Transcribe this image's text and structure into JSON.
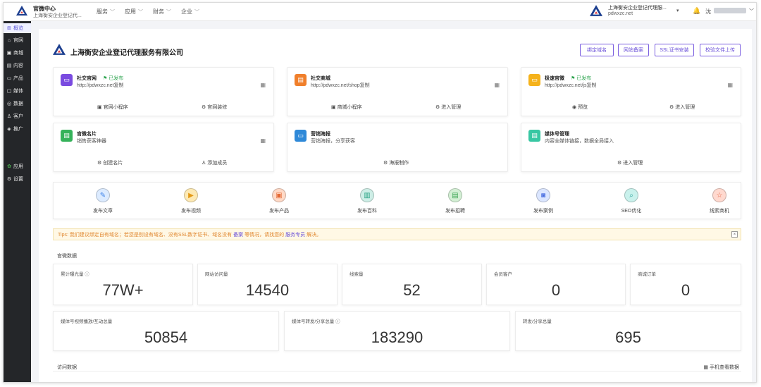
{
  "topbar": {
    "app_title": "官微中心",
    "app_subtitle": "上海衡安企业登记代...",
    "nav": [
      "服务",
      "应用",
      "财务",
      "企业"
    ],
    "account_name": "上海衡安企业登记代理服...",
    "account_domain": "pdwxzc.net",
    "user_name": "沈"
  },
  "sidebar": {
    "items": [
      {
        "label": "概览",
        "icon": "grid-icon"
      },
      {
        "label": "官网",
        "icon": "home-icon"
      },
      {
        "label": "商城",
        "icon": "shop-icon"
      },
      {
        "label": "内容",
        "icon": "file-icon"
      },
      {
        "label": "产品",
        "icon": "box-icon"
      },
      {
        "label": "媒体",
        "icon": "media-icon"
      },
      {
        "label": "数据",
        "icon": "data-icon"
      },
      {
        "label": "客户",
        "icon": "user-icon"
      },
      {
        "label": "推广",
        "icon": "megaphone-icon"
      }
    ],
    "bottom": [
      {
        "label": "应用",
        "icon": "apps-icon"
      },
      {
        "label": "设置",
        "icon": "gear-icon"
      }
    ]
  },
  "main": {
    "company": "上海衡安企业登记代理服务有限公司",
    "buttons": [
      "绑定域名",
      "网站备案",
      "SSL证书安装",
      "校验文件上传"
    ],
    "cards": [
      {
        "title": "社交官网",
        "badge": "已发布",
        "sub": "http://pdwxzc.net复制",
        "a1": "官网小程序",
        "a2": "官网装修",
        "color": "#7a4be0"
      },
      {
        "title": "社交商城",
        "badge": "",
        "sub": "http://pdwxzc.net/shop复制",
        "a1": "商城小程序",
        "a2": "进入管理",
        "color": "#f07f2b"
      },
      {
        "title": "极速官微",
        "badge": "已发布",
        "sub": "http://pdwxzc.net/js复制",
        "a1": "预览",
        "a2": "进入管理",
        "color": "#f5b21b"
      },
      {
        "title": "官微名片",
        "badge": "",
        "sub": "销售获客神器",
        "a1": "创建名片",
        "a2": "添加成员",
        "color": "#35b25a"
      },
      {
        "title": "营销海报",
        "badge": "",
        "sub": "营销海报，分享获客",
        "a1": "海报制作",
        "a2": "",
        "color": "#2f89d8"
      },
      {
        "title": "媒体号管理",
        "badge": "",
        "sub": "内容全媒体链接，数据全局接入",
        "a1": "进入管理",
        "a2": "",
        "color": "#38c7a3"
      }
    ],
    "quick": [
      {
        "label": "发布文章",
        "icon": "edit-icon",
        "bg": "#dcebff",
        "fg": "#3d82e8"
      },
      {
        "label": "发布视频",
        "icon": "play-icon",
        "bg": "#fde9b3",
        "fg": "#e49a17"
      },
      {
        "label": "发布产品",
        "icon": "gift-icon",
        "bg": "#ffd9c6",
        "fg": "#e46a35"
      },
      {
        "label": "发布百科",
        "icon": "book-icon",
        "bg": "#cdeee6",
        "fg": "#2aa385"
      },
      {
        "label": "发布招聘",
        "icon": "doc-icon",
        "bg": "#d3efd4",
        "fg": "#3aa552"
      },
      {
        "label": "发布案例",
        "icon": "case-icon",
        "bg": "#dbe6ff",
        "fg": "#4a6fe0"
      },
      {
        "label": "SEO优化",
        "icon": "search-icon",
        "bg": "#c9f1ec",
        "fg": "#2aa39a"
      },
      {
        "label": "线索商机",
        "icon": "star-icon",
        "bg": "#ffd9cf",
        "fg": "#e2694a"
      }
    ],
    "tips": {
      "prefix": "Tips: 我们建议绑定自有域名；若您是别设有域名、没有SSL数字证书、域名没有",
      "link1": "备案",
      "middle": "等情况，请找您的",
      "link2": "服务专员",
      "suffix": "解决。"
    },
    "official_title": "官微数据",
    "stats_row1": [
      {
        "label": "累计曝光量 ⓘ",
        "value": "77W+"
      },
      {
        "label": "网站访问量",
        "value": "14540"
      },
      {
        "label": "线索量",
        "value": "52"
      },
      {
        "label": "会员客户",
        "value": "0"
      },
      {
        "label": "商城订单",
        "value": "0"
      }
    ],
    "stats_row2": [
      {
        "label": "媒体号视频播放/互动总量",
        "value": "50854"
      },
      {
        "label": "媒体号转发/分享总量 ⓘ",
        "value": "183290"
      },
      {
        "label": "转发/分享总量",
        "value": "695"
      }
    ],
    "visit_title": "访问数据",
    "phone_data": "手机查看数据"
  }
}
